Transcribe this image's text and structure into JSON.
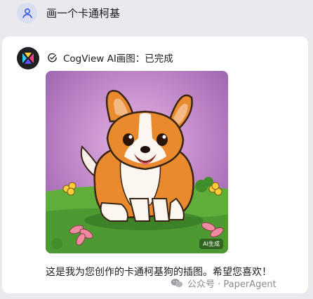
{
  "user_message": {
    "text": "画一个卡通柯基"
  },
  "assistant": {
    "status_text": "CogView AI画图：已完成",
    "image": {
      "badge": "AI生成",
      "subject": "corgi-illustration"
    },
    "reply_text": "这是我为您创作的卡通柯基狗的插图。希望您喜欢！"
  },
  "watermark": {
    "text": "公众号 · PaperAgent"
  },
  "icons": {
    "user_avatar": "user-icon",
    "bot_avatar": "zhipu-logo-icon",
    "status": "check-circle-icon",
    "watermark": "wechat-icon"
  },
  "colors": {
    "background": "#e9e9ee",
    "card": "#ffffff",
    "user_icon": "#3b5bdb",
    "status_ok": "#1c1c1f"
  }
}
